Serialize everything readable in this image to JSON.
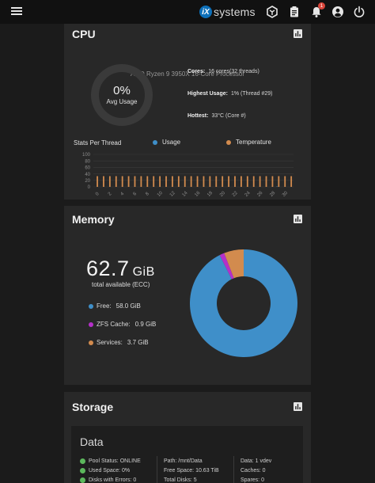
{
  "topbar": {
    "logo_mark": "iX",
    "logo_text": "systems",
    "alert_count": "1"
  },
  "cpu": {
    "title": "CPU",
    "model": "AMD Ryzen 9 3950X 16-Core Processor",
    "avg_value": "0%",
    "avg_label": "Avg Usage",
    "avg_usage_fraction": 0,
    "cores_label": "Cores:",
    "cores_value": "16 cores(32 threads)",
    "highest_label": "Highest Usage:",
    "highest_value": "1%  (Thread #29)",
    "hottest_label": "Hottest:",
    "hottest_value": "33°C  (Core #)",
    "threads_title": "Stats Per Thread",
    "legend_usage": "Usage",
    "legend_temp": "Temperature",
    "colors": {
      "usage": "#3f8fc9",
      "temperature": "#d28b4e"
    }
  },
  "chart_data": {
    "type": "bar",
    "categories": [
      "0",
      "1",
      "2",
      "3",
      "4",
      "5",
      "6",
      "7",
      "8",
      "9",
      "10",
      "11",
      "12",
      "13",
      "14",
      "15",
      "16",
      "17",
      "18",
      "19",
      "20",
      "21",
      "22",
      "23",
      "24",
      "25",
      "26",
      "27",
      "28",
      "29",
      "30",
      "31"
    ],
    "x_tick_labels": [
      "0",
      "2",
      "4",
      "6",
      "8",
      "10",
      "12",
      "14",
      "16",
      "18",
      "20",
      "22",
      "24",
      "26",
      "28",
      "30"
    ],
    "y_ticks": [
      "100",
      "80",
      "60",
      "40",
      "20",
      "0"
    ],
    "ylim": [
      0,
      100
    ],
    "series": [
      {
        "name": "Usage",
        "values": [
          0,
          0,
          0,
          0,
          0,
          0,
          0,
          0,
          0,
          0,
          0,
          0,
          0,
          0,
          0,
          0,
          0,
          0,
          0,
          0,
          0,
          0,
          0,
          0,
          0,
          0,
          0,
          0,
          0,
          1,
          0,
          0
        ]
      },
      {
        "name": "Temperature",
        "values": [
          33,
          33,
          33,
          33,
          33,
          33,
          33,
          33,
          33,
          33,
          33,
          33,
          33,
          33,
          33,
          33,
          33,
          33,
          33,
          33,
          33,
          33,
          33,
          33,
          33,
          33,
          33,
          33,
          33,
          33,
          33,
          33
        ]
      }
    ],
    "grid": true,
    "legend": "top"
  },
  "memory": {
    "title": "Memory",
    "total_value": "62.7",
    "total_unit": "GiB",
    "total_label": "total available (ECC)",
    "legend": [
      {
        "label": "Free:",
        "value": "58.0 GiB",
        "amount": 58.0,
        "color": "#3f8fc9"
      },
      {
        "label": "ZFS Cache:",
        "value": "0.9 GiB",
        "amount": 0.9,
        "color": "#b530c9"
      },
      {
        "label": "Services:",
        "value": "3.7 GiB",
        "amount": 3.7,
        "color": "#d28b4e"
      }
    ]
  },
  "storage": {
    "title": "Storage",
    "pool_name": "Data",
    "pool_status": "Pool Status:  ONLINE",
    "used_space": "Used Space:  0%",
    "disks_errors": "Disks with Errors:  0",
    "path": "Path:  /mnt/Data",
    "free_space": "Free Space:  10.63 TiB",
    "total_disks": "Total Disks:  5",
    "data": "Data:  1 vdev",
    "caches": "Caches:  0",
    "spares": "Spares:  0"
  }
}
